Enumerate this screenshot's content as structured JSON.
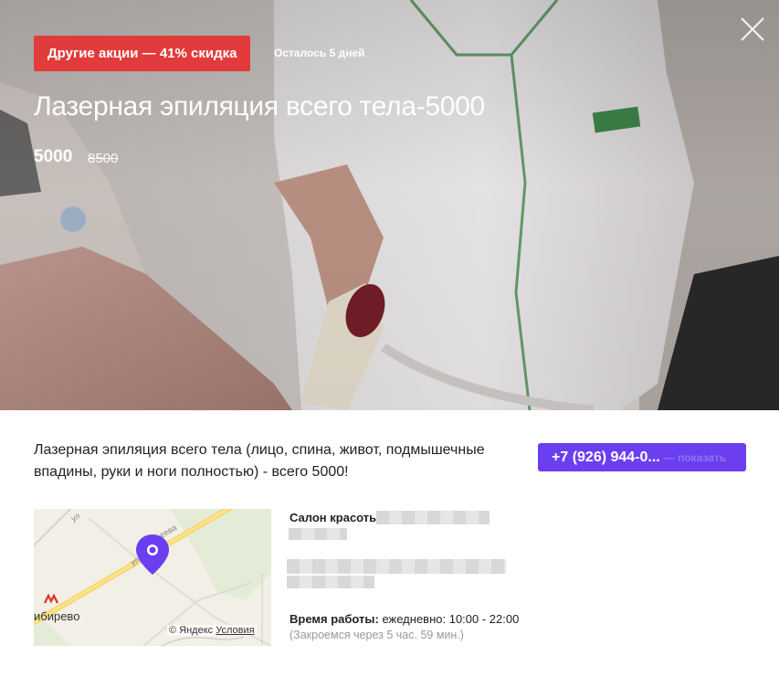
{
  "promo": {
    "badge": "Другие акции — 41% скидка",
    "days_left": "Осталось 5 дней",
    "title": "Лазерная эпиляция всего тела-5000",
    "price": "5000",
    "old_price": "8500"
  },
  "description": "Лазерная эпиляция всего тела (лицо, спина, живот, подмышечные впадины, руки и ноги полностью) - всего 5000!",
  "phone": {
    "number": "+7 (926) 944-0...",
    "show_label": "— показать"
  },
  "map": {
    "street_label_1": "ул",
    "street_label_2": "ул",
    "street_label_3": "еева",
    "metro_station": "ибирево",
    "copyright": "© Яндекс",
    "terms_link": "Условия"
  },
  "salon": {
    "label": "Салон красоты"
  },
  "hours": {
    "label": "Время работы:",
    "value": "ежедневно: 10:00 - 22:00",
    "closes_in": "(Закроемся через 5 час. 59 мин.)"
  },
  "colors": {
    "badge_red": "#e23b3b",
    "accent_purple": "#6b3ef0",
    "map_pin": "#6b3ef0"
  },
  "icons": {
    "close": "close-icon",
    "pin": "map-pin-icon",
    "metro": "metro-icon"
  }
}
